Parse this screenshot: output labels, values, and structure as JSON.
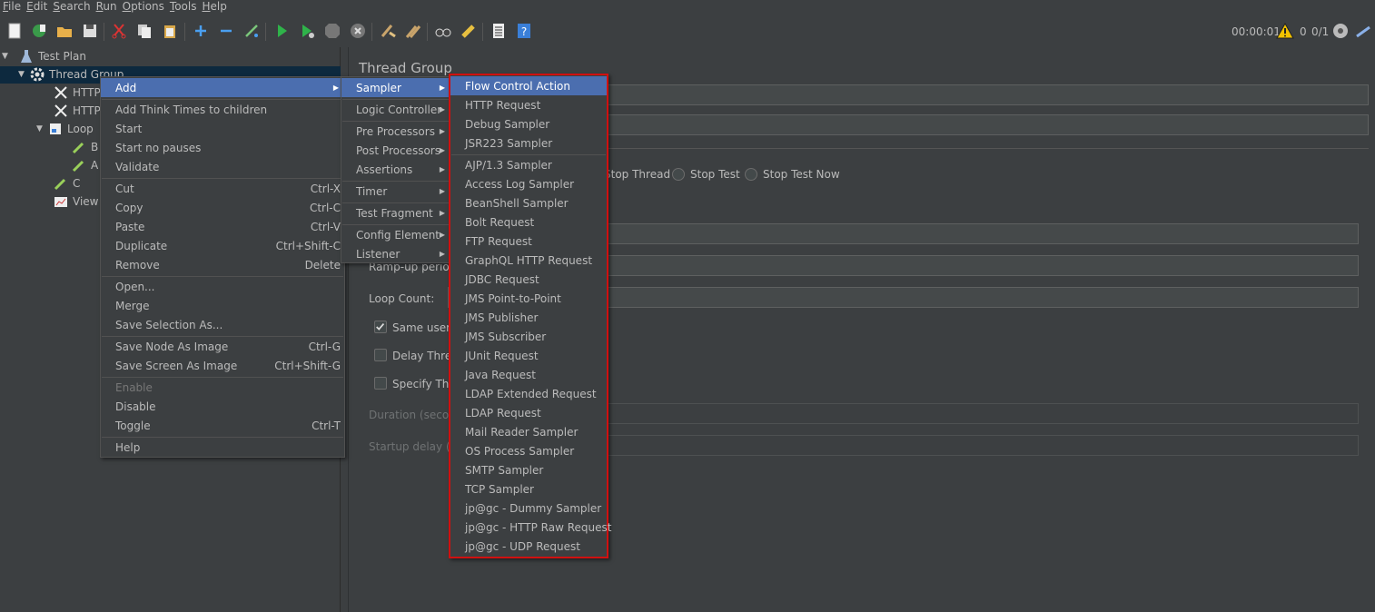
{
  "menubar": [
    "File",
    "Edit",
    "Search",
    "Run",
    "Options",
    "Tools",
    "Help"
  ],
  "status": {
    "elapsed": "00:00:01",
    "warnings": "0",
    "threads": "0/1"
  },
  "tree": {
    "test_plan": "Test Plan",
    "thread_group": "Thread Group",
    "http1": "HTTP",
    "http2": "HTTP",
    "loop": "Loop",
    "child_b": "B",
    "child_a": "A",
    "c": "C",
    "view": "View"
  },
  "pane": {
    "title": "Thread Group",
    "stop_thread": "Stop Thread",
    "stop_test": "Stop Test",
    "stop_test_now": "Stop Test Now",
    "ramp_up": "Ramp-up period",
    "loop_count": "Loop Count:",
    "same_user": "Same user o",
    "delay_thread": "Delay Threa",
    "specify_thread": "Specify Thre",
    "duration": "Duration (second",
    "startup_delay": "Startup delay (se"
  },
  "context_menu": {
    "add": "Add",
    "add_think": "Add Think Times to children",
    "start": "Start",
    "start_no_pauses": "Start no pauses",
    "validate": "Validate",
    "cut": "Cut",
    "cut_key": "Ctrl-X",
    "copy": "Copy",
    "copy_key": "Ctrl-C",
    "paste": "Paste",
    "paste_key": "Ctrl-V",
    "duplicate": "Duplicate",
    "duplicate_key": "Ctrl+Shift-C",
    "remove": "Remove",
    "remove_key": "Delete",
    "open": "Open...",
    "merge": "Merge",
    "save_selection": "Save Selection As...",
    "save_node_image": "Save Node As Image",
    "save_node_image_key": "Ctrl-G",
    "save_screen_image": "Save Screen As Image",
    "save_screen_image_key": "Ctrl+Shift-G",
    "enable": "Enable",
    "disable": "Disable",
    "toggle": "Toggle",
    "toggle_key": "Ctrl-T",
    "help": "Help"
  },
  "add_menu": {
    "sampler": "Sampler",
    "logic_controller": "Logic Controller",
    "pre_processors": "Pre Processors",
    "post_processors": "Post Processors",
    "assertions": "Assertions",
    "timer": "Timer",
    "test_fragment": "Test Fragment",
    "config_element": "Config Element",
    "listener": "Listener"
  },
  "sampler_menu": {
    "group1": [
      "Flow Control Action",
      "HTTP Request",
      "Debug Sampler",
      "JSR223 Sampler"
    ],
    "group2": [
      "AJP/1.3 Sampler",
      "Access Log Sampler",
      "BeanShell Sampler",
      "Bolt Request",
      "FTP Request",
      "GraphQL HTTP Request",
      "JDBC Request",
      "JMS Point-to-Point",
      "JMS Publisher",
      "JMS Subscriber",
      "JUnit Request",
      "Java Request",
      "LDAP Extended Request",
      "LDAP Request",
      "Mail Reader Sampler",
      "OS Process Sampler",
      "SMTP Sampler",
      "TCP Sampler",
      "jp@gc - Dummy Sampler",
      "jp@gc - HTTP Raw Request",
      "jp@gc - UDP Request"
    ]
  },
  "colors": {
    "highlight": "#4b6eaf",
    "annotation_border": "#d01010",
    "background": "#3c3f41"
  }
}
